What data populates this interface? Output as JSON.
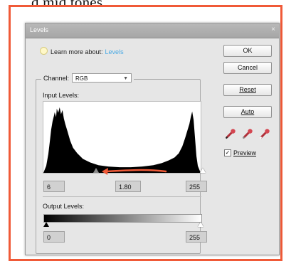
{
  "top_text": "d mid tones.",
  "window": {
    "title": "Levels",
    "close_glyph": "×"
  },
  "learn": {
    "prefix": "Learn more about:",
    "link": "Levels"
  },
  "buttons": {
    "ok": "OK",
    "cancel": "Cancel",
    "reset": "Reset",
    "auto": "Auto"
  },
  "channel": {
    "label": "Channel:",
    "value": "RGB"
  },
  "input_levels": {
    "label": "Input Levels:",
    "black": "6",
    "gamma": "1.80",
    "white": "255"
  },
  "output_levels": {
    "label": "Output Levels:",
    "black": "0",
    "white": "255"
  },
  "preview": {
    "label": "Preview",
    "checked": true,
    "check_glyph": "✓"
  },
  "icons": [
    "info-bulb-icon",
    "close-icon",
    "black-eyedropper-icon",
    "gray-eyedropper-icon",
    "white-eyedropper-icon",
    "annotation-arrow-icon"
  ],
  "colors": {
    "annotation_frame": "#f05a38",
    "link": "#49a9e4"
  }
}
